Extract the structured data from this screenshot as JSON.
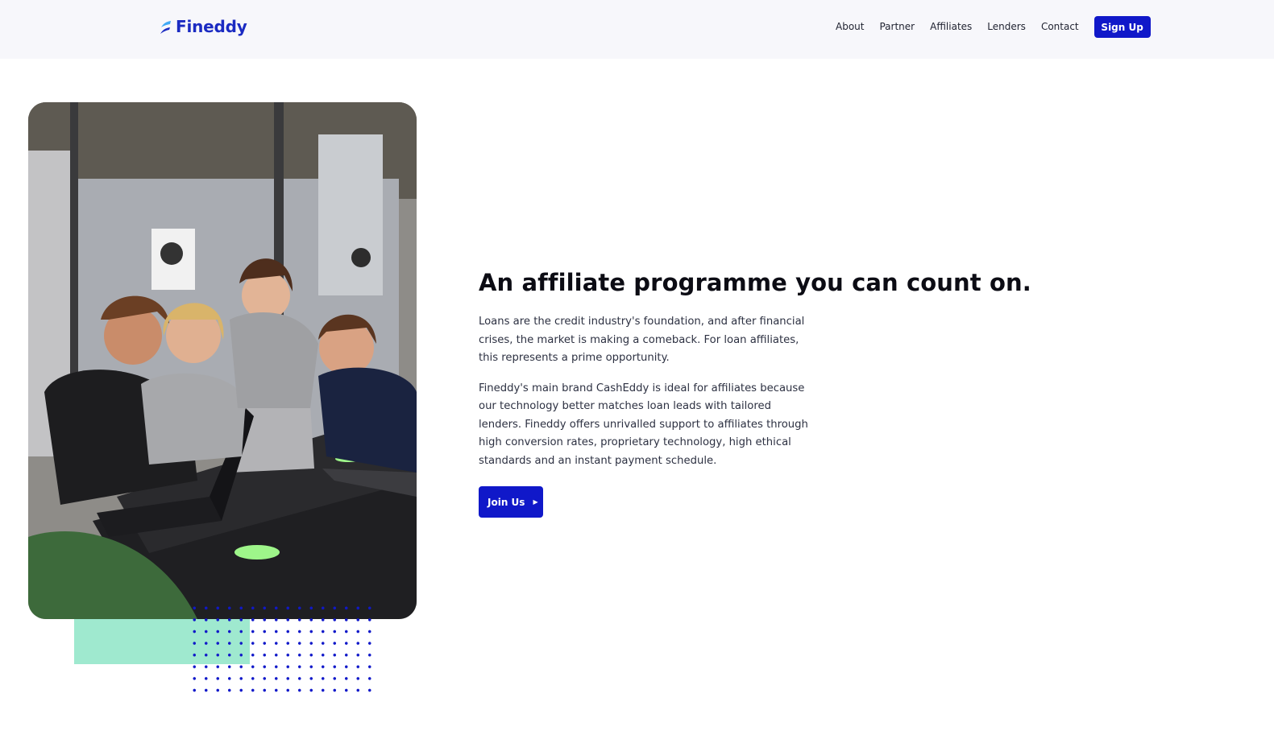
{
  "brand": {
    "name": "Fineddy",
    "logo_icon": "fineddy-swoosh-icon",
    "color": "#1b2bc2"
  },
  "nav": {
    "items": [
      {
        "label": "About"
      },
      {
        "label": "Partner"
      },
      {
        "label": "Affiliates"
      },
      {
        "label": "Lenders"
      },
      {
        "label": "Contact"
      }
    ],
    "signup_label": "Sign Up"
  },
  "hero": {
    "headline": "An affiliate programme you can count on.",
    "paragraphs": [
      "Loans are the credit industry's foundation, and after financial crises, the market is making a comeback. For loan affiliates, this represents a prime opportunity.",
      "Fineddy's main brand CashEddy is ideal for affiliates because our technology better matches loan leads with tailored lenders. Fineddy offers unrivalled support to affiliates through high conversion rates, proprietary technology, high ethical standards and an instant payment schedule."
    ],
    "cta_label": "Join Us",
    "cta_icon": "caret-right-icon",
    "image_icon": "team-photo"
  },
  "colors": {
    "primary": "#1018c9",
    "accent_mint": "#9fe9cf",
    "header_bg": "#f7f7fb",
    "text_dark": "#0c0c14"
  }
}
